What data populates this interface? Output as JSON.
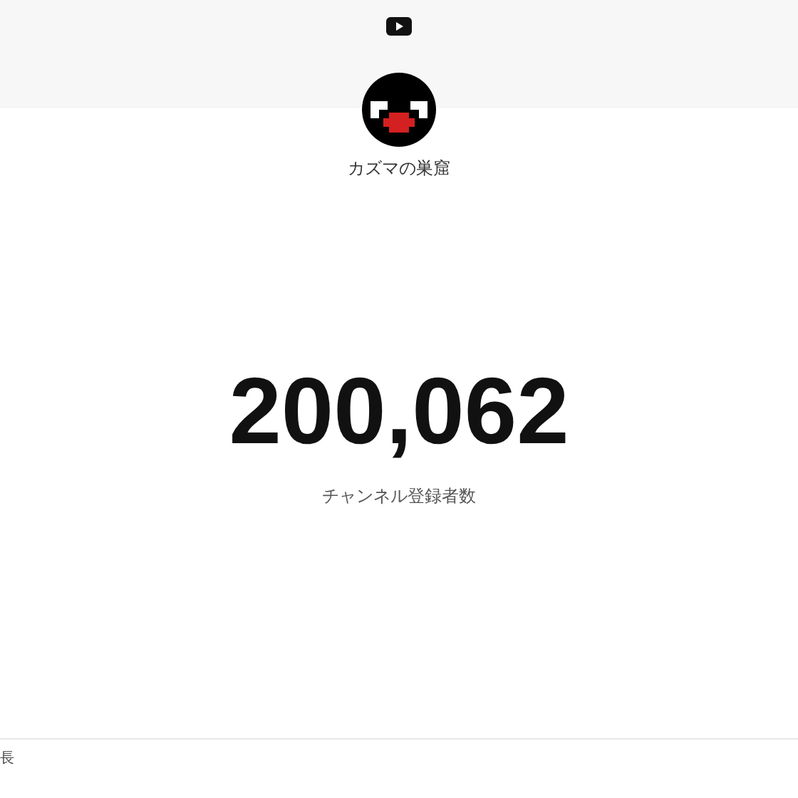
{
  "channel": {
    "name": "カズマの巣窟"
  },
  "counter": {
    "value": "200,062",
    "label": "チャンネル登録者数"
  },
  "footer": {
    "text": "長"
  }
}
